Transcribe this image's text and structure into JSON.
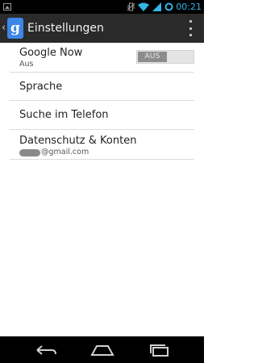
{
  "status_bar": {
    "time": "00:21",
    "icons": [
      "notification-icon",
      "vibrate-icon",
      "wifi-icon",
      "signal-icon",
      "sync-icon"
    ],
    "time_color": "#33b5e5"
  },
  "action_bar": {
    "icon_letter": "g",
    "title": "Einstellungen"
  },
  "settings": {
    "google_now": {
      "title": "Google Now",
      "summary": "Aus",
      "toggle_label": "AUS"
    },
    "sprache": {
      "title": "Sprache"
    },
    "suche": {
      "title": "Suche im Telefon"
    },
    "konten": {
      "title": "Datenschutz & Konten",
      "account_suffix": "@gmail.com"
    }
  },
  "nav_bar": {
    "buttons": [
      "back-icon",
      "home-icon",
      "recent-apps-icon"
    ]
  }
}
